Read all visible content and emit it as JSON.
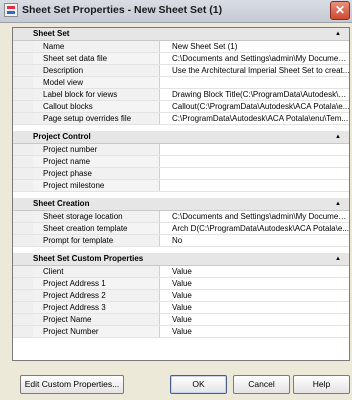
{
  "window": {
    "title": "Sheet Set Properties - New Sheet Set (1)",
    "close": "✕"
  },
  "sections": [
    {
      "title": "Sheet Set",
      "rows": [
        {
          "name": "Name",
          "value": "New Sheet Set (1)"
        },
        {
          "name": "Sheet set data file",
          "value": "C:\\Documents and Settings\\admin\\My Document..."
        },
        {
          "name": "Description",
          "value": "Use the Architectural Imperial Sheet Set to creat..."
        },
        {
          "name": "Model view",
          "value": ""
        },
        {
          "name": "Label block for views",
          "value": "Drawing Block Title(C:\\ProgramData\\Autodesk\\A..."
        },
        {
          "name": "Callout blocks",
          "value": "Callout(C:\\ProgramData\\Autodesk\\ACA Potala\\e..."
        },
        {
          "name": "Page setup overrides file",
          "value": "C:\\ProgramData\\Autodesk\\ACA Potala\\enu\\Tem..."
        }
      ]
    },
    {
      "title": "Project Control",
      "rows": [
        {
          "name": "Project number",
          "value": ""
        },
        {
          "name": "Project name",
          "value": ""
        },
        {
          "name": "Project phase",
          "value": ""
        },
        {
          "name": "Project milestone",
          "value": ""
        }
      ]
    },
    {
      "title": "Sheet Creation",
      "rows": [
        {
          "name": "Sheet storage location",
          "value": "C:\\Documents and Settings\\admin\\My Document..."
        },
        {
          "name": "Sheet creation template",
          "value": "Arch D(C:\\ProgramData\\Autodesk\\ACA Potala\\e..."
        },
        {
          "name": "Prompt for template",
          "value": "No"
        }
      ]
    },
    {
      "title": "Sheet Set Custom Properties",
      "rows": [
        {
          "name": "Client",
          "value": "Value"
        },
        {
          "name": "Project Address 1",
          "value": "Value"
        },
        {
          "name": "Project Address 2",
          "value": "Value"
        },
        {
          "name": "Project Address 3",
          "value": "Value"
        },
        {
          "name": "Project Name",
          "value": "Value"
        },
        {
          "name": "Project Number",
          "value": "Value"
        }
      ]
    }
  ],
  "buttons": {
    "edit_custom": "Edit Custom Properties...",
    "ok": "OK",
    "cancel": "Cancel",
    "help": "Help"
  },
  "icons": {
    "collapse": "▲"
  }
}
